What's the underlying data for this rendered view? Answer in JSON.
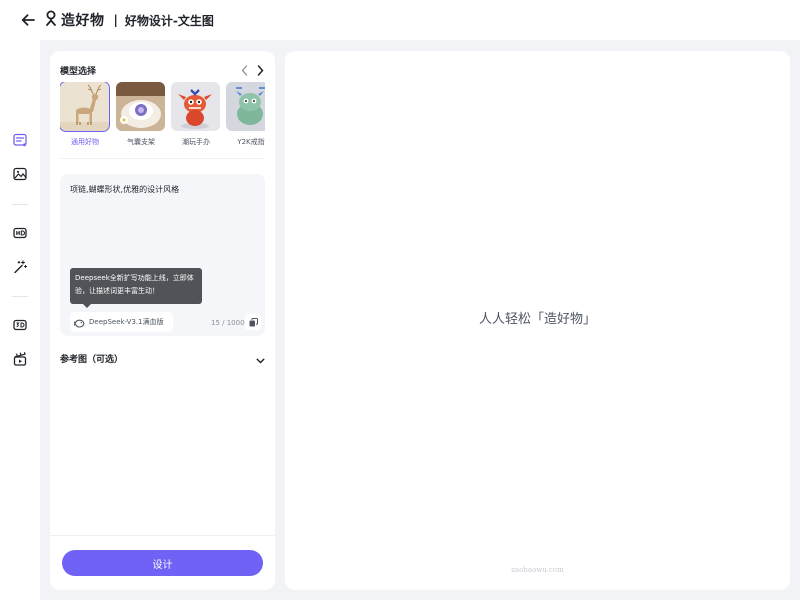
{
  "header": {
    "logo_text": "造好物",
    "separator": "|",
    "title": "好物设计-文生图"
  },
  "rail": {
    "items": [
      "text-to-image-icon",
      "image-to-image-icon",
      "hd-icon",
      "magic-wand-icon",
      "3d-icon",
      "film-clapper-icon"
    ]
  },
  "model_section": {
    "title": "模型选择",
    "models": [
      {
        "label": "通用好物",
        "selected": true
      },
      {
        "label": "气囊支架",
        "selected": false
      },
      {
        "label": "潮玩手办",
        "selected": false
      },
      {
        "label": "Y2K戒指",
        "selected": false
      }
    ]
  },
  "prompt": {
    "text": "项链,蝴蝶形状,优雅的设计风格",
    "tooltip": "Deepseek全新扩写功能上线，立即体验，让描述词更丰富生动！",
    "deepseek_label": "DeepSeek-V3.1满血版",
    "char_count": "15 / 1000"
  },
  "reference": {
    "title": "参考图（可选）"
  },
  "design_button": "设计",
  "canvas": {
    "slogan": "人人轻松「造好物」",
    "footer": "zaohaowu.com"
  },
  "colors": {
    "accent": "#6f62f4",
    "background": "#f2f3f6",
    "tooltip": "#505357"
  }
}
